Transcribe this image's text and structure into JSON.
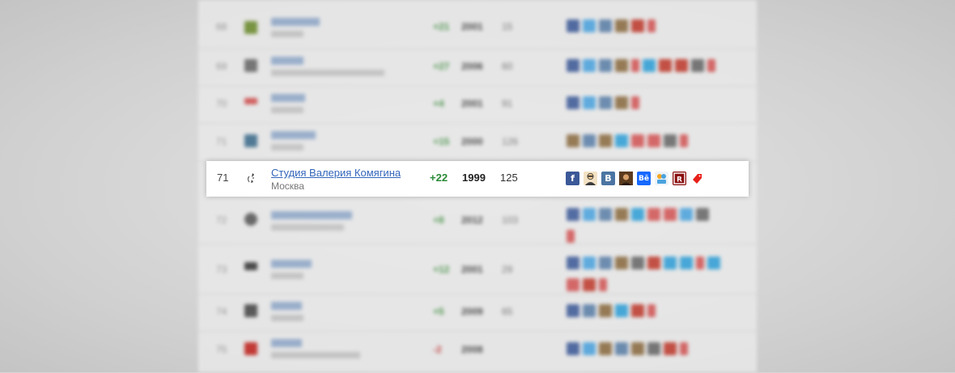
{
  "highlight_row": {
    "rank": "71",
    "studio_name": "Студия Валерия Комягина",
    "city": "Москва",
    "delta": "+22",
    "year": "1999",
    "count": "125",
    "social_icons": [
      {
        "name": "facebook-icon",
        "glyph": "f",
        "color": "#3b5998"
      },
      {
        "name": "avatar-person-icon",
        "glyph": "",
        "color": "#f5d9a8"
      },
      {
        "name": "vk-icon",
        "glyph": "B",
        "color": "#4c75a3"
      },
      {
        "name": "avatar-photo-icon",
        "glyph": "",
        "color": "#8a5a2b"
      },
      {
        "name": "behance-icon",
        "glyph": "Bē",
        "color": "#1769ff"
      },
      {
        "name": "moikrug-icon",
        "glyph": "",
        "color": "#f5a623"
      },
      {
        "name": "rating-runet-icon",
        "glyph": "R",
        "color": "#a51c1c"
      },
      {
        "name": "red-tag-icon",
        "glyph": "",
        "color": "#e8201a"
      }
    ]
  }
}
